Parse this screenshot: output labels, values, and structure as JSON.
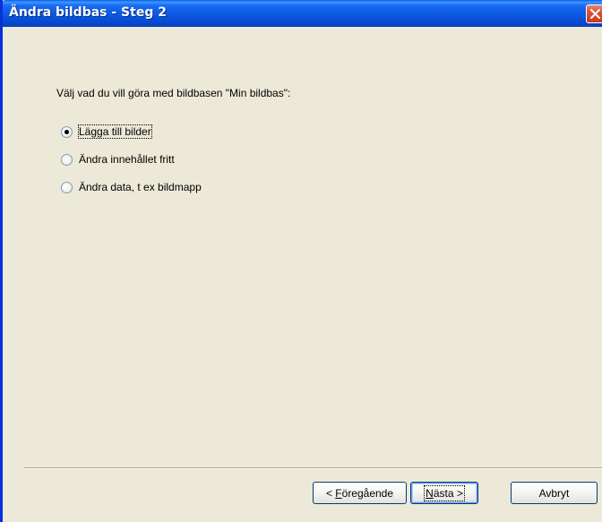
{
  "window": {
    "title": "Ändra bildbas - Steg 2",
    "close_icon": "close-icon"
  },
  "content": {
    "prompt": "Välj vad du vill göra med bildbasen \"Min bildbas\":",
    "options": [
      {
        "label": "Lägga till bilder",
        "checked": true
      },
      {
        "label": "Ändra innehållet fritt",
        "checked": false
      },
      {
        "label": "Ändra data, t ex bildmapp",
        "checked": false
      }
    ]
  },
  "buttons": {
    "back": {
      "prefix": "< ",
      "mnemonic": "F",
      "rest": "öregående"
    },
    "next": {
      "mnemonic": "N",
      "rest": "ästa",
      "suffix": " >"
    },
    "cancel": "Avbryt"
  },
  "colors": {
    "titlebar": "#0A58E0",
    "dialog_bg": "#ECE9D8",
    "close_button": "#D9533A"
  }
}
